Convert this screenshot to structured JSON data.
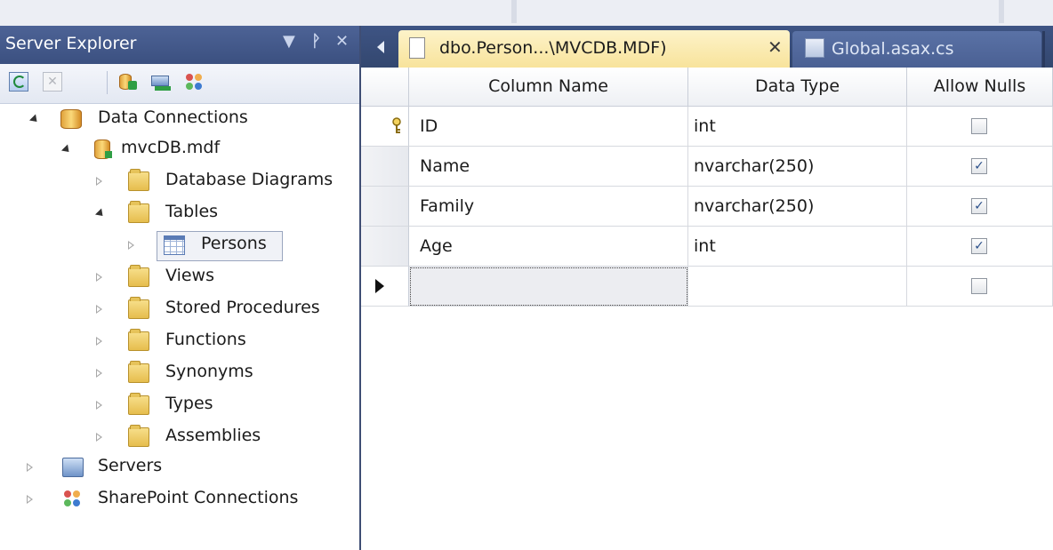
{
  "server_explorer": {
    "title": "Server Explorer",
    "controls": {
      "dropdown": "▼",
      "pin": "ᵖ",
      "close": "✕"
    },
    "toolbar": [
      "refresh-icon",
      "stop-icon",
      "connect-to-database-icon",
      "connect-to-server-icon",
      "connect-to-sharepoint-icon"
    ],
    "tree": {
      "data_connections": "Data Connections",
      "database": "mvcDB.mdf",
      "database_diagrams": "Database Diagrams",
      "tables": "Tables",
      "persons": "Persons",
      "views": "Views",
      "stored_procedures": "Stored Procedures",
      "functions": "Functions",
      "synonyms": "Synonyms",
      "types": "Types",
      "assemblies": "Assemblies",
      "servers": "Servers",
      "sharepoint": "SharePoint Connections"
    }
  },
  "editor": {
    "active_tab": "dbo.Person...\\MVCDB.MDF)",
    "active_tab_close": "✕",
    "inactive_tab": "Global.asax.cs",
    "columns": {
      "name": "Column Name",
      "type": "Data Type",
      "nulls": "Allow Nulls"
    },
    "rows": [
      {
        "name": "ID",
        "type": "int",
        "allow_nulls": "",
        "primary_key": true
      },
      {
        "name": "Name",
        "type": "nvarchar(250)",
        "allow_nulls": "✓",
        "primary_key": false
      },
      {
        "name": "Family",
        "type": "nvarchar(250)",
        "allow_nulls": "✓",
        "primary_key": false
      },
      {
        "name": "Age",
        "type": "int",
        "allow_nulls": "✓",
        "primary_key": false
      },
      {
        "name": "",
        "type": "",
        "allow_nulls": "",
        "primary_key": false
      }
    ]
  },
  "colors": {
    "title_bar": "#3b5080",
    "active_tab": "#f8e39b",
    "folder": "#e6bd4d"
  }
}
